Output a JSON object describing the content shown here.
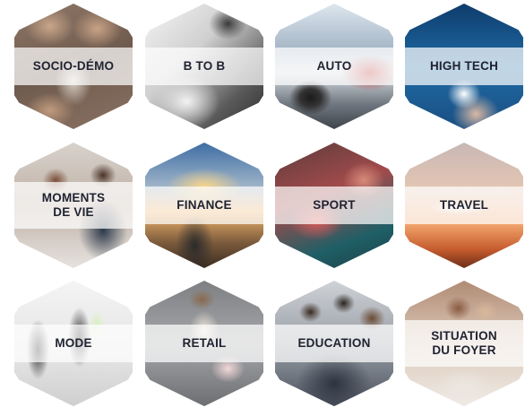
{
  "tiles": [
    {
      "label": "SOCIO-DÉMO"
    },
    {
      "label": "B TO B"
    },
    {
      "label": "AUTO"
    },
    {
      "label": "HIGH  TECH"
    },
    {
      "label": "MOMENTS\nDE VIE"
    },
    {
      "label": "FINANCE"
    },
    {
      "label": "SPORT"
    },
    {
      "label": "TRAVEL"
    },
    {
      "label": "MODE"
    },
    {
      "label": "RETAIL"
    },
    {
      "label": "EDUCATION"
    },
    {
      "label": "SITUATION\nDU FOYER"
    }
  ]
}
